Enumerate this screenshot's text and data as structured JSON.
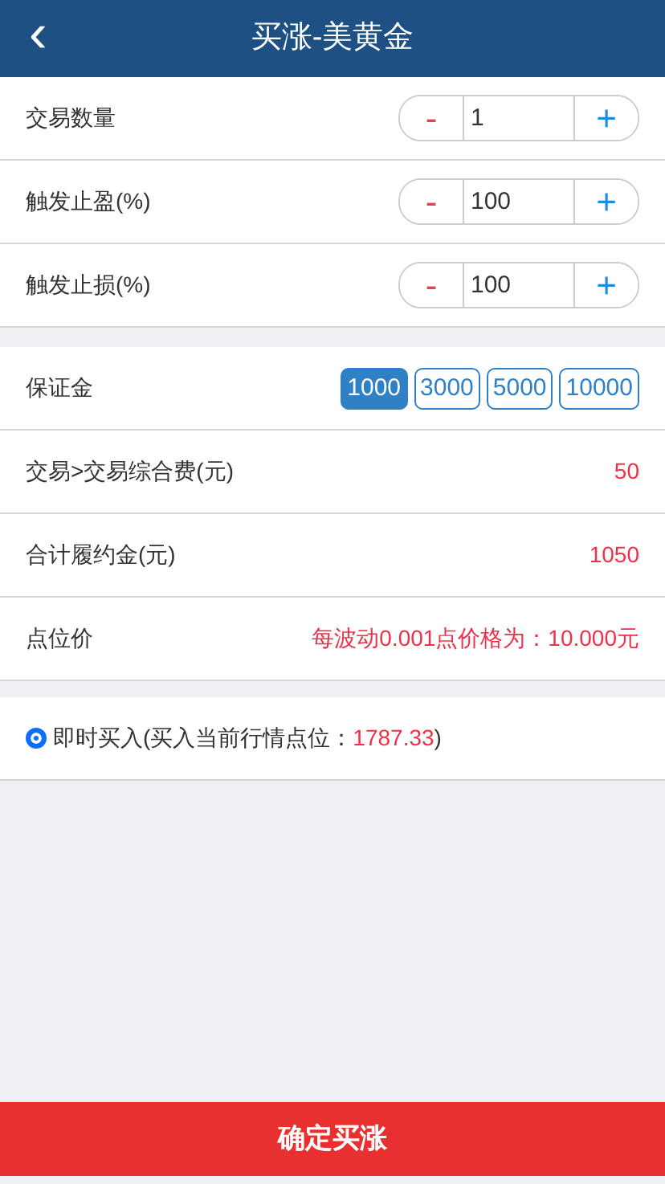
{
  "header": {
    "back": "‹",
    "title": "买涨-美黄金"
  },
  "steppers": [
    {
      "label": "交易数量",
      "minus": "-",
      "value": "1",
      "plus": "+"
    },
    {
      "label": "触发止盈(%)",
      "minus": "-",
      "value": "100",
      "plus": "+"
    },
    {
      "label": "触发止损(%)",
      "minus": "-",
      "value": "100",
      "plus": "+"
    }
  ],
  "margin": {
    "label": "保证金",
    "options": [
      {
        "label": "1000",
        "selected": true
      },
      {
        "label": "3000",
        "selected": false
      },
      {
        "label": "5000",
        "selected": false
      },
      {
        "label": "10000",
        "selected": false
      }
    ]
  },
  "info_rows": [
    {
      "label": "交易>交易综合费(元)",
      "value": "50"
    },
    {
      "label": "合计履约金(元)",
      "value": "1050"
    },
    {
      "label": "点位价",
      "value": "每波动0.001点价格为：10.000元"
    }
  ],
  "buy_option": {
    "selected": true,
    "prefix": "即时买入(买入当前行情点位：",
    "price": "1787.33",
    "suffix": ")"
  },
  "confirm_button": "确定买涨"
}
